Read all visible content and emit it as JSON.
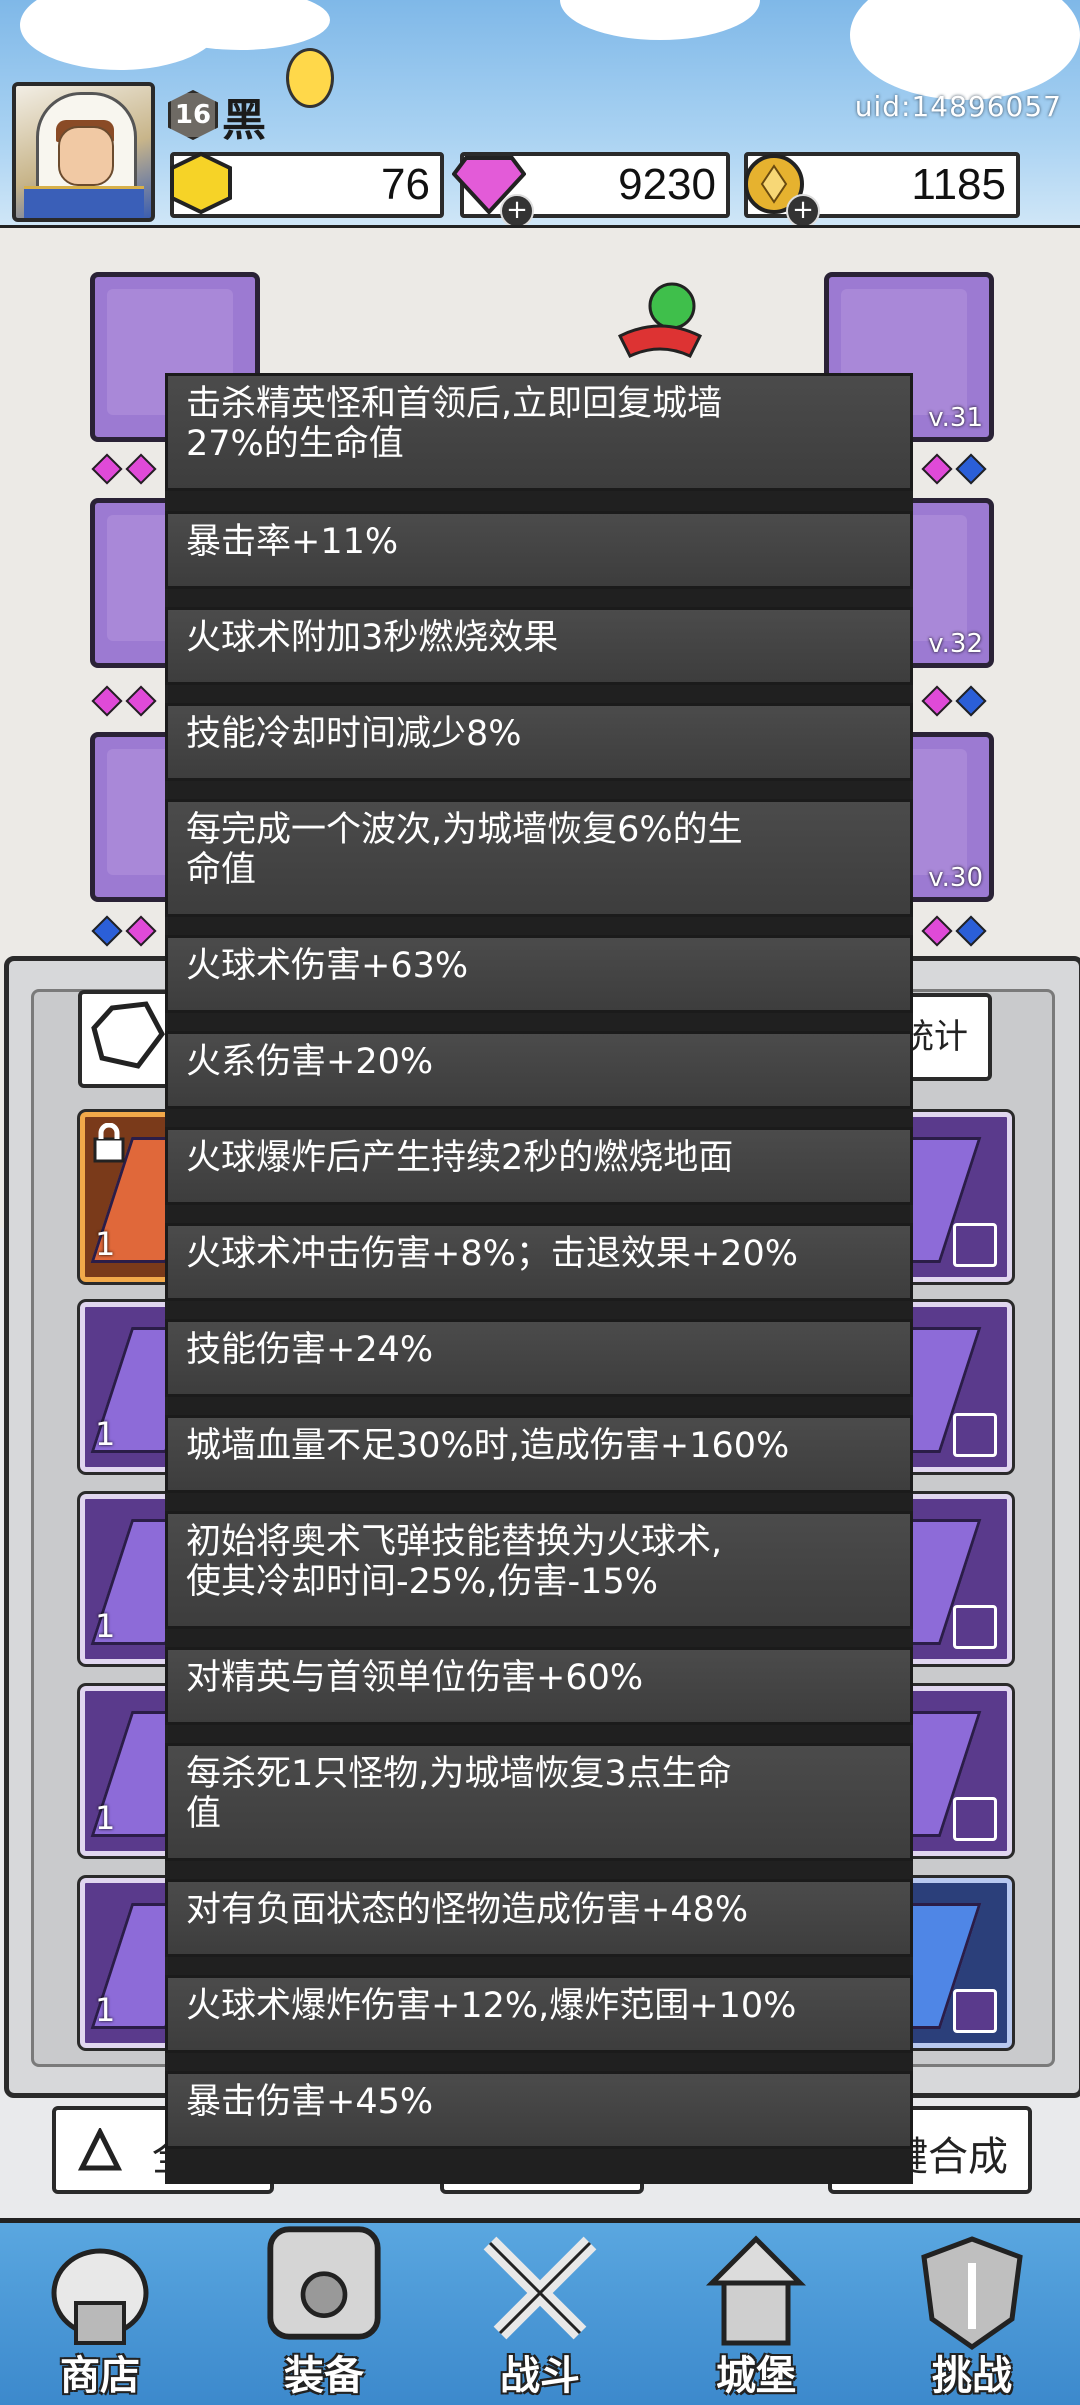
{
  "header": {
    "level": "16",
    "player_name": "黑",
    "uid": "uid:14896057",
    "currencies": [
      {
        "name": "gold-gem",
        "value": "76",
        "color": "#f6d327"
      },
      {
        "name": "diamond",
        "value": "9230",
        "color": "#e35bd8"
      },
      {
        "name": "coin",
        "value": "1185",
        "color": "#e6b22f"
      }
    ]
  },
  "equipment": {
    "slots_right_levels": [
      "v.31",
      "v.32",
      "v.30"
    ]
  },
  "panel": {
    "stats_button": "属性统计",
    "card_counts": [
      "1",
      "1",
      "1",
      "1",
      "1"
    ],
    "bottom_left_label": "全部",
    "bottom_right_label": "一键合成"
  },
  "nav": [
    {
      "label": "商店",
      "icon": "shop-icon"
    },
    {
      "label": "装备",
      "icon": "equipment-icon"
    },
    {
      "label": "战斗",
      "icon": "battle-icon"
    },
    {
      "label": "城堡",
      "icon": "castle-icon"
    },
    {
      "label": "挑战",
      "icon": "challenge-icon"
    }
  ],
  "skills": [
    {
      "line1": "击杀精英怪和首领后,立即回复城墙",
      "line2": "27%的生命值"
    },
    {
      "line1": "暴击率+11%",
      "line2": ""
    },
    {
      "line1": "火球术附加3秒燃烧效果",
      "line2": ""
    },
    {
      "line1": "技能冷却时间减少8%",
      "line2": ""
    },
    {
      "line1": "每完成一个波次,为城墙恢复6%的生",
      "line2": "命值"
    },
    {
      "line1": "火球术伤害+63%",
      "line2": ""
    },
    {
      "line1": "火系伤害+20%",
      "line2": ""
    },
    {
      "line1": "火球爆炸后产生持续2秒的燃烧地面",
      "line2": ""
    },
    {
      "line1": "火球术冲击伤害+8%；击退效果+20%",
      "line2": ""
    },
    {
      "line1": "技能伤害+24%",
      "line2": ""
    },
    {
      "line1": "城墙血量不足30%时,造成伤害+160%",
      "line2": ""
    },
    {
      "line1": "初始将奥术飞弹技能替换为火球术,",
      "line2": "使其冷却时间-25%,伤害-15%"
    },
    {
      "line1": "对精英与首领单位伤害+60%",
      "line2": ""
    },
    {
      "line1": "每杀死1只怪物,为城墙恢复3点生命",
      "line2": "值"
    },
    {
      "line1": "对有负面状态的怪物造成伤害+48%",
      "line2": ""
    },
    {
      "line1": "火球术爆炸伤害+12%,爆炸范围+10%",
      "line2": ""
    },
    {
      "line1": "暴击伤害+45%",
      "line2": ""
    }
  ]
}
